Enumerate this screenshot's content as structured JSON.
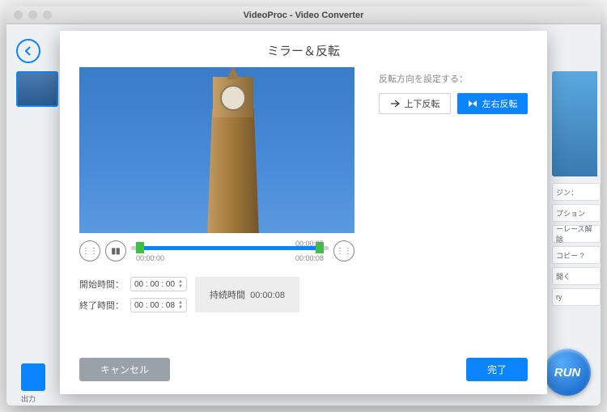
{
  "window": {
    "title": "VideoProc - Video Converter"
  },
  "background": {
    "runLabel": "RUN",
    "outLabel": "出力",
    "sideButtons": [
      "ジン：",
      "プション",
      "ーレース解除",
      "コピー ?",
      "開く",
      "ry"
    ]
  },
  "modal": {
    "title": "ミラー＆反転",
    "playback": {
      "startMark": "00:00:00",
      "endMark": "00:00:05",
      "totalMark": "00:00:08"
    },
    "times": {
      "startLabel": "開始時間：",
      "endLabel": "終了時間：",
      "startValue": "00 : 00 : 00",
      "endValue": "00 : 00 : 08",
      "durationPrefix": "持続時間",
      "durationValue": "00:00:08"
    },
    "flip": {
      "sectionLabel": "反転方向を設定する：",
      "vertical": "上下反転",
      "horizontal": "左右反転"
    },
    "footer": {
      "cancel": "キャンセル",
      "done": "完了"
    }
  }
}
